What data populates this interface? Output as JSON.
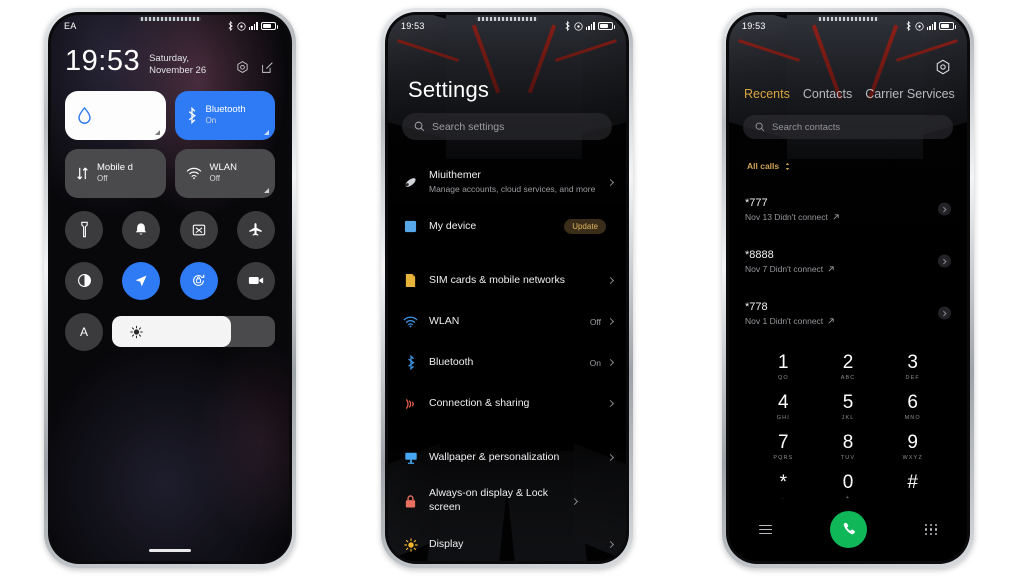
{
  "phone1": {
    "status": {
      "carrier": "EA",
      "icons": [
        "bluetooth-icon",
        "dnd-icon",
        "signal-icon",
        "battery-icon"
      ]
    },
    "clock": {
      "time": "19:53",
      "date": "Saturday, November 26"
    },
    "actions": [
      {
        "name": "settings-gear-icon"
      },
      {
        "name": "edit-tiles-icon"
      }
    ],
    "big_tiles": [
      {
        "label": "",
        "state": "",
        "icon": "water-drop-icon",
        "style": "white"
      },
      {
        "label": "Bluetooth",
        "state": "On",
        "icon": "bluetooth-icon",
        "style": "blue"
      },
      {
        "label": "Mobile d",
        "state": "Off",
        "icon": "mobile-data-icon",
        "style": "grey"
      },
      {
        "label": "WLAN",
        "state": "Off",
        "icon": "wifi-icon",
        "style": "grey"
      }
    ],
    "round_tiles": [
      {
        "icon": "flashlight-icon",
        "on": false
      },
      {
        "icon": "bell-icon",
        "on": false
      },
      {
        "icon": "screenshot-icon",
        "on": false
      },
      {
        "icon": "airplane-icon",
        "on": false
      },
      {
        "icon": "dark-mode-icon",
        "on": false
      },
      {
        "icon": "location-icon",
        "on": true
      },
      {
        "icon": "auto-rotate-icon",
        "on": true
      },
      {
        "icon": "screen-record-icon",
        "on": false
      }
    ],
    "brightness": {
      "auto_label": "A",
      "icon": "sun-icon",
      "level": 73
    }
  },
  "phone2": {
    "status": {
      "time": "19:53"
    },
    "title": "Settings",
    "search": {
      "placeholder": "Search settings",
      "icon": "search-icon"
    },
    "rows": [
      {
        "type": "row",
        "icon": "account-icon",
        "title": "Miuithemer",
        "subtitle": "Manage accounts, cloud services, and more",
        "value": "",
        "badge": "",
        "chevron": true
      },
      {
        "type": "row",
        "icon": "device-icon",
        "title": "My device",
        "subtitle": "",
        "value": "",
        "badge": "Update",
        "chevron": false
      },
      {
        "type": "gap"
      },
      {
        "type": "row",
        "icon": "sim-card-icon",
        "title": "SIM cards & mobile networks",
        "subtitle": "",
        "value": "",
        "badge": "",
        "chevron": true
      },
      {
        "type": "row",
        "icon": "wifi-icon",
        "title": "WLAN",
        "subtitle": "",
        "value": "Off",
        "badge": "",
        "chevron": true
      },
      {
        "type": "row",
        "icon": "bluetooth-icon",
        "title": "Bluetooth",
        "subtitle": "",
        "value": "On",
        "badge": "",
        "chevron": true
      },
      {
        "type": "row",
        "icon": "connection-sharing-icon",
        "title": "Connection & sharing",
        "subtitle": "",
        "value": "",
        "badge": "",
        "chevron": true
      },
      {
        "type": "gap"
      },
      {
        "type": "row",
        "icon": "wallpaper-icon",
        "title": "Wallpaper & personalization",
        "subtitle": "",
        "value": "",
        "badge": "",
        "chevron": true
      },
      {
        "type": "row",
        "icon": "lock-icon",
        "title": "Always-on display & Lock screen",
        "subtitle": "",
        "value": "",
        "badge": "",
        "chevron": true
      },
      {
        "type": "row",
        "icon": "display-brightness-icon",
        "title": "Display",
        "subtitle": "",
        "value": "",
        "badge": "",
        "chevron": true
      }
    ]
  },
  "phone3": {
    "status": {
      "time": "19:53"
    },
    "gear_icon": "settings-hex-icon",
    "tabs": [
      {
        "label": "Recents",
        "active": true
      },
      {
        "label": "Contacts",
        "active": false
      },
      {
        "label": "Carrier Services",
        "active": false
      }
    ],
    "search": {
      "placeholder": "Search contacts",
      "icon": "search-icon"
    },
    "filter": {
      "label": "All calls",
      "icon": "sort-chevron-icon"
    },
    "calls": [
      {
        "number": "*777",
        "detail": "Nov 13 Didn't connect"
      },
      {
        "number": "*8888",
        "detail": "Nov 7 Didn't connect"
      },
      {
        "number": "*778",
        "detail": "Nov 1 Didn't connect"
      }
    ],
    "keypad": [
      {
        "digit": "1",
        "letters": "QO"
      },
      {
        "digit": "2",
        "letters": "ABC"
      },
      {
        "digit": "3",
        "letters": "DEF"
      },
      {
        "digit": "4",
        "letters": "GHI"
      },
      {
        "digit": "5",
        "letters": "JKL"
      },
      {
        "digit": "6",
        "letters": "MNO"
      },
      {
        "digit": "7",
        "letters": "PQRS"
      },
      {
        "digit": "8",
        "letters": "TUV"
      },
      {
        "digit": "9",
        "letters": "WXYZ"
      },
      {
        "digit": "*",
        "letters": "."
      },
      {
        "digit": "0",
        "letters": "+"
      },
      {
        "digit": "#",
        "letters": ""
      }
    ],
    "pad_actions": [
      {
        "name": "menu-icon"
      },
      {
        "name": "call-button"
      },
      {
        "name": "keypad-icon"
      }
    ]
  },
  "colors": {
    "accent_blue": "#2f7bf6",
    "accent_gold": "#d9a441",
    "call_green": "#10b759",
    "badge_text": "#e0b562",
    "page_bg": "#ffffff"
  }
}
